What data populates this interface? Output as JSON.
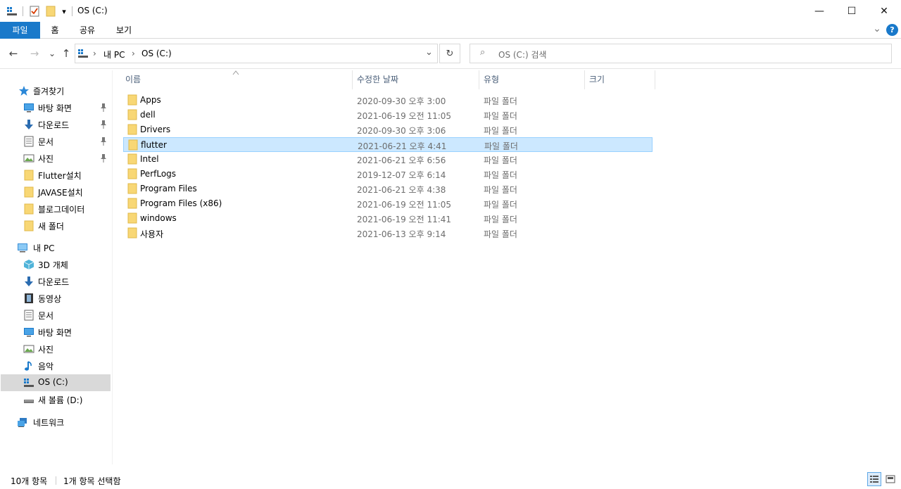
{
  "window": {
    "title": "OS (C:)",
    "minimize_glyph": "—",
    "maximize_glyph": "☐",
    "close_glyph": "✕",
    "quick_access_dropdown_glyph": "▾"
  },
  "ribbon": {
    "tabs": [
      {
        "label": "파일"
      },
      {
        "label": "홈"
      },
      {
        "label": "공유"
      },
      {
        "label": "보기"
      }
    ],
    "expand_glyph": "⌄",
    "help_label": "?"
  },
  "address": {
    "back_glyph": "←",
    "forward_glyph": "→",
    "recent_glyph": "⌄",
    "up_glyph": "↑",
    "crumb_sep": "›",
    "crumbs": [
      "내 PC",
      "OS (C:)"
    ],
    "dropdown_glyph": "⌄",
    "refresh_glyph": "↻",
    "search_placeholder": "OS (C:) 검색",
    "search_glyph": "⌕"
  },
  "nav": {
    "quick_access": "즐겨찾기",
    "quick_items": [
      {
        "label": "바탕 화면",
        "icon": "desktop-icon",
        "pinned": true
      },
      {
        "label": "다운로드",
        "icon": "downloads-icon",
        "pinned": true
      },
      {
        "label": "문서",
        "icon": "documents-icon",
        "pinned": true
      },
      {
        "label": "사진",
        "icon": "pictures-icon",
        "pinned": true
      },
      {
        "label": "Flutter설치",
        "icon": "folder-icon",
        "pinned": false
      },
      {
        "label": "JAVASE설치",
        "icon": "folder-icon",
        "pinned": false
      },
      {
        "label": "블로그데이터",
        "icon": "folder-icon",
        "pinned": false
      },
      {
        "label": "새 폴더",
        "icon": "folder-icon",
        "pinned": false
      }
    ],
    "this_pc": "내 PC",
    "pc_items": [
      {
        "label": "3D 개체",
        "icon": "3d-objects-icon"
      },
      {
        "label": "다운로드",
        "icon": "downloads-icon"
      },
      {
        "label": "동영상",
        "icon": "videos-icon"
      },
      {
        "label": "문서",
        "icon": "documents-icon"
      },
      {
        "label": "바탕 화면",
        "icon": "desktop-icon"
      },
      {
        "label": "사진",
        "icon": "pictures-icon"
      },
      {
        "label": "음악",
        "icon": "music-icon"
      },
      {
        "label": "OS (C:)",
        "icon": "system-drive-icon",
        "selected": true
      },
      {
        "label": "새 볼륨 (D:)",
        "icon": "drive-icon"
      }
    ],
    "network": "네트워크"
  },
  "columns": {
    "name": "이름",
    "date": "수정한 날짜",
    "type": "유형",
    "size": "크기"
  },
  "files": [
    {
      "name": "Apps",
      "date": "2020-09-30 오후 3:00",
      "type": "파일 폴더"
    },
    {
      "name": "dell",
      "date": "2021-06-19 오전 11:05",
      "type": "파일 폴더"
    },
    {
      "name": "Drivers",
      "date": "2020-09-30 오후 3:06",
      "type": "파일 폴더"
    },
    {
      "name": "flutter",
      "date": "2021-06-21 오후 4:41",
      "type": "파일 폴더",
      "selected": true
    },
    {
      "name": "Intel",
      "date": "2021-06-21 오후 6:56",
      "type": "파일 폴더"
    },
    {
      "name": "PerfLogs",
      "date": "2019-12-07 오후 6:14",
      "type": "파일 폴더"
    },
    {
      "name": "Program Files",
      "date": "2021-06-21 오후 4:38",
      "type": "파일 폴더"
    },
    {
      "name": "Program Files (x86)",
      "date": "2021-06-19 오전 11:05",
      "type": "파일 폴더"
    },
    {
      "name": "windows",
      "date": "2021-06-19 오전 11:41",
      "type": "파일 폴더"
    },
    {
      "name": "사용자",
      "date": "2021-06-13 오후 9:14",
      "type": "파일 폴더"
    }
  ],
  "status": {
    "item_count": "10개 항목",
    "selected_count": "1개 항목 선택함"
  },
  "colors": {
    "accent": "#1979ca",
    "selection_bg": "#cce8ff",
    "selection_border": "#99d1ff",
    "folder": "#f8d775",
    "header_text": "#4c607a"
  }
}
